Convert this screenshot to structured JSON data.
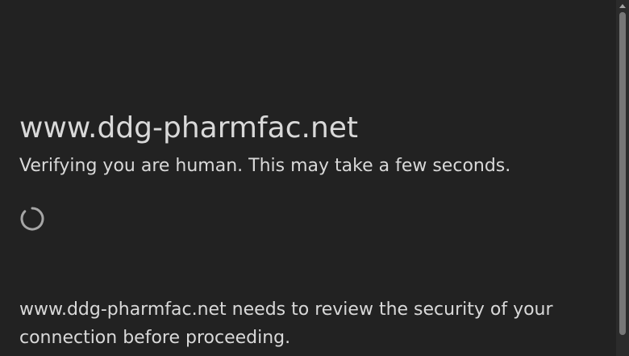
{
  "page": {
    "host": "www.ddg-pharmfac.net",
    "verification_message": "Verifying you are human. This may take a few seconds.",
    "security_notice": "www.ddg-pharmfac.net needs to review the security of your connection before proceeding."
  },
  "icons": {
    "loading": "loading-spinner-icon"
  },
  "colors": {
    "background": "#222222",
    "text": "#d9d9d9",
    "spinner": "#a6a6a6",
    "scrollbar": "#2b2b2b",
    "scrollbar_thumb": "#777777"
  }
}
